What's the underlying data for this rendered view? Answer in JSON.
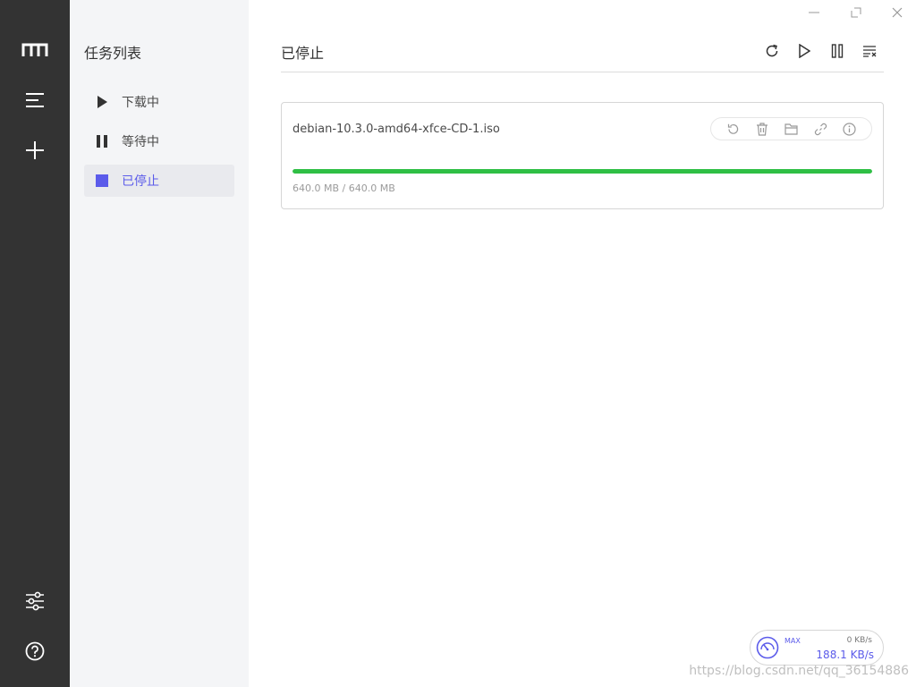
{
  "colors": {
    "rail": "#333333",
    "subnav": "#f4f5f7",
    "accent": "#5b5bea",
    "progress": "#2fbf45"
  },
  "rail": {
    "icons": [
      "logo-icon",
      "task-list-icon",
      "add-task-icon",
      "preferences-icon",
      "help-icon"
    ]
  },
  "sidebar": {
    "title": "任务列表",
    "items": [
      {
        "label": "下载中",
        "icon": "play-icon"
      },
      {
        "label": "等待中",
        "icon": "pause-icon"
      },
      {
        "label": "已停止",
        "icon": "stop-icon",
        "active": true
      }
    ]
  },
  "window": {
    "controls": [
      "minimize-icon",
      "maximize-icon",
      "close-icon"
    ]
  },
  "main": {
    "title": "已停止",
    "toolbar": [
      "refresh-icon",
      "resume-all-icon",
      "pause-all-icon",
      "purge-list-icon"
    ]
  },
  "task": {
    "name": "debian-10.3.0-amd64-xfce-CD-1.iso",
    "progress": 1.0,
    "size_text": "640.0 MB / 640.0 MB",
    "actions": [
      "restart-icon",
      "delete-icon",
      "folder-icon",
      "link-icon",
      "info-icon"
    ]
  },
  "speedometer": {
    "max_label": "MAX",
    "upload": "0 KB/s",
    "download": "188.1 KB/s"
  },
  "watermark": "https://blog.csdn.net/qq_36154886"
}
